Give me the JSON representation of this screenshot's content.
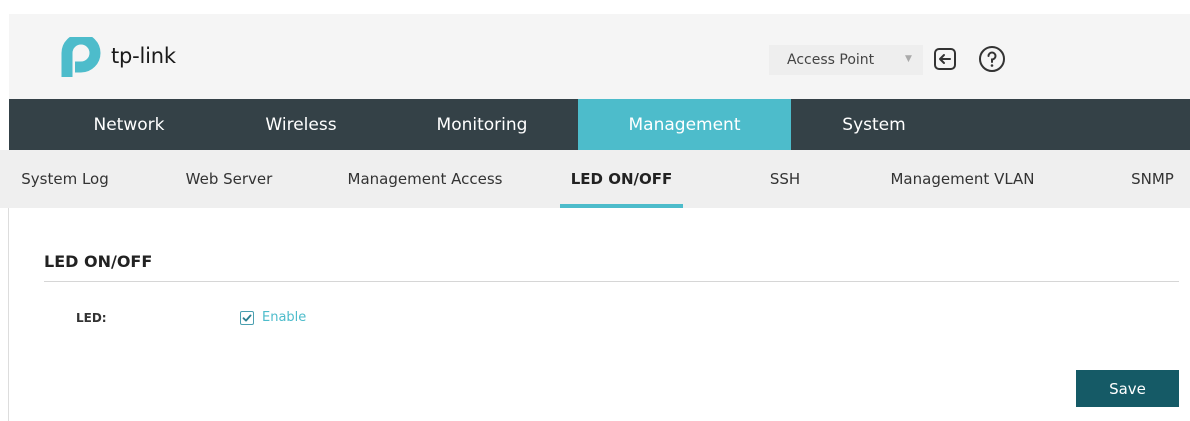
{
  "brand": {
    "logo_text": "tp-link",
    "accent_color": "#4dbccb",
    "nav_color": "#344147",
    "button_color": "#155a66"
  },
  "header": {
    "mode": {
      "selected": "Access Point",
      "icon": "chevron-down-icon"
    },
    "icons": [
      "logout-icon",
      "help-icon"
    ]
  },
  "main_nav": {
    "tabs": [
      {
        "label": "Network",
        "active": false
      },
      {
        "label": "Wireless",
        "active": false
      },
      {
        "label": "Monitoring",
        "active": false
      },
      {
        "label": "Management",
        "active": true
      },
      {
        "label": "System",
        "active": false
      }
    ]
  },
  "sub_nav": {
    "tabs": [
      {
        "label": "System Log",
        "active": false
      },
      {
        "label": "Web Server",
        "active": false
      },
      {
        "label": "Management Access",
        "active": false
      },
      {
        "label": "LED ON/OFF",
        "active": true
      },
      {
        "label": "SSH",
        "active": false
      },
      {
        "label": "Management VLAN",
        "active": false
      },
      {
        "label": "SNMP",
        "active": false
      }
    ]
  },
  "content": {
    "section_title": "LED ON/OFF",
    "led_field": {
      "label": "LED:",
      "checkbox_label": "Enable",
      "checked": true
    },
    "save_label": "Save"
  }
}
